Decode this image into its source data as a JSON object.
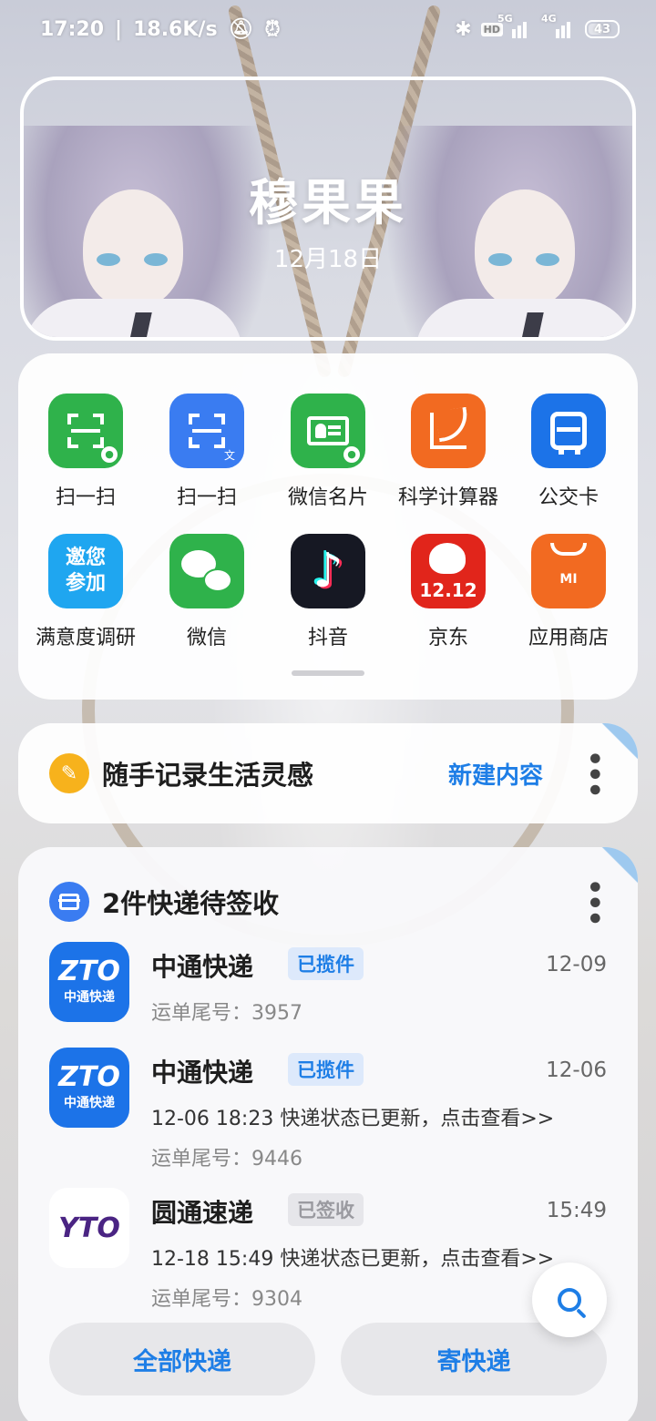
{
  "status_bar": {
    "time": "17:20",
    "speed": "18.6K/s",
    "network_5g": "5G",
    "network_4g": "4G",
    "hd": "HD",
    "battery": "43",
    "icons": [
      "silent-icon",
      "alarm-icon",
      "bluetooth-icon",
      "hd-icon",
      "signal-icon",
      "battery-icon"
    ]
  },
  "header": {
    "title": "穆果果",
    "date": "12月18日"
  },
  "apps": [
    {
      "label": "扫一扫",
      "color": "#2fb24b",
      "icon": "wechat-scan-icon"
    },
    {
      "label": "扫一扫",
      "color": "#3a7cf1",
      "icon": "translate-scan-icon"
    },
    {
      "label": "微信名片",
      "color": "#2fb24b",
      "icon": "wechat-card-icon"
    },
    {
      "label": "科学计算器",
      "color": "#f26a21",
      "icon": "calculator-icon"
    },
    {
      "label": "公交卡",
      "color": "#1c73e8",
      "icon": "bus-card-icon"
    },
    {
      "label": "满意度调研",
      "color": "#1fa6f0",
      "icon": "survey-icon",
      "tile_text": "邀您参加"
    },
    {
      "label": "微信",
      "color": "#2fb24b",
      "icon": "wechat-icon"
    },
    {
      "label": "抖音",
      "color": "#161823",
      "icon": "douyin-icon"
    },
    {
      "label": "京东",
      "color": "#e1251b",
      "icon": "jd-icon",
      "tile_text": "12.12"
    },
    {
      "label": "应用商店",
      "color": "#f26a21",
      "icon": "app-store-icon",
      "tile_text": "MI"
    }
  ],
  "note_card": {
    "text": "随手记录生活灵感",
    "action": "新建内容"
  },
  "parcel_card": {
    "title": "2件快递待签收",
    "items": [
      {
        "company": "中通快递",
        "status": "已揽件",
        "time": "12-09",
        "detail": "",
        "tail": "运单尾号：3957",
        "logo_big": "ZTO",
        "logo_small": "中通快递"
      },
      {
        "company": "中通快递",
        "status": "已揽件",
        "time": "12-06",
        "detail": "12-06 18:23 快递状态已更新，点击查看>>",
        "tail": "运单尾号：9446",
        "logo_big": "ZTO",
        "logo_small": "中通快递"
      },
      {
        "company": "圆通速递",
        "status": "已签收",
        "time": "15:49",
        "detail": "12-18 15:49 快递状态已更新，点击查看>>",
        "tail": "运单尾号：9304",
        "logo_big": "YTO"
      }
    ],
    "btn_all": "全部快递",
    "btn_send": "寄快递"
  }
}
